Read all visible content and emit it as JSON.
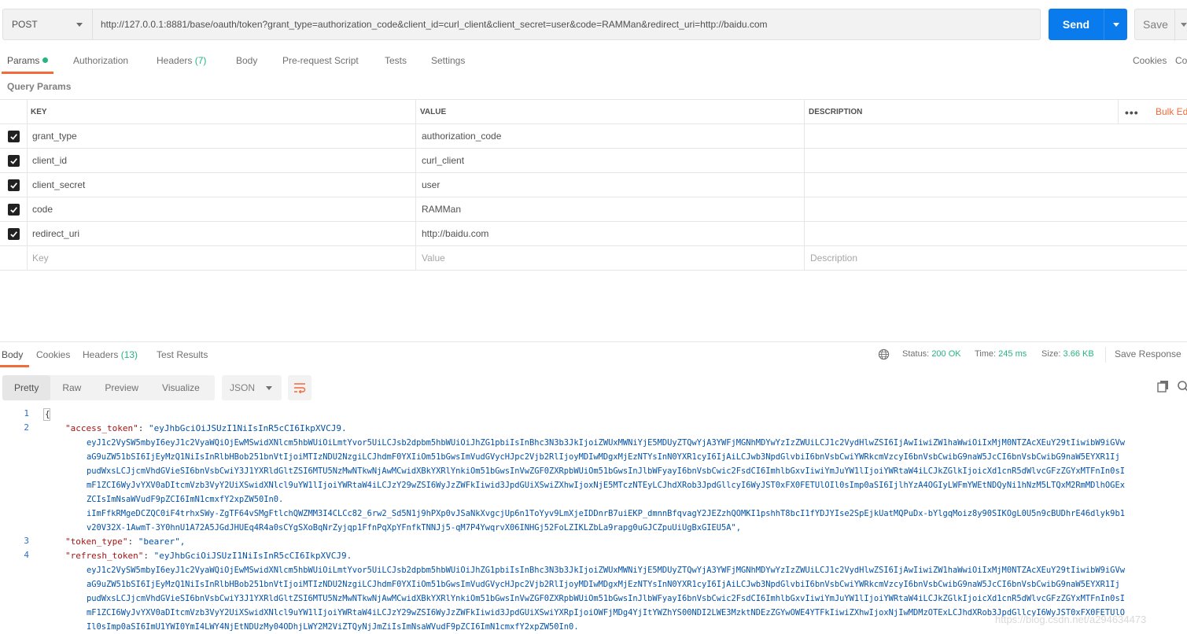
{
  "request": {
    "method": "POST",
    "url": "http://127.0.0.1:8881/base/oauth/token?grant_type=authorization_code&client_id=curl_client&client_secret=user&code=RAMMan&redirect_uri=http://baidu.com",
    "send_label": "Send",
    "save_label": "Save"
  },
  "request_tabs": {
    "params": "Params",
    "authorization": "Authorization",
    "headers": "Headers",
    "headers_count": "(7)",
    "body": "Body",
    "prerequest": "Pre-request Script",
    "tests": "Tests",
    "settings": "Settings",
    "cookies": "Cookies",
    "code": "Co"
  },
  "query_params": {
    "title": "Query Params",
    "columns": {
      "key": "KEY",
      "value": "VALUE",
      "description": "DESCRIPTION"
    },
    "bulk_edit": "Bulk Ed",
    "more": "•••",
    "rows": [
      {
        "key": "grant_type",
        "value": "authorization_code",
        "checked": true
      },
      {
        "key": "client_id",
        "value": "curl_client",
        "checked": true
      },
      {
        "key": "client_secret",
        "value": "user",
        "checked": true
      },
      {
        "key": "code",
        "value": "RAMMan",
        "checked": true
      },
      {
        "key": "redirect_uri",
        "value": "http://baidu.com",
        "checked": true
      }
    ],
    "placeholders": {
      "key": "Key",
      "value": "Value",
      "description": "Description"
    }
  },
  "response": {
    "tabs": {
      "body": "Body",
      "cookies": "Cookies",
      "headers": "Headers",
      "headers_count": "(13)",
      "test_results": "Test Results"
    },
    "status_label": "Status:",
    "status_value": "200 OK",
    "time_label": "Time:",
    "time_value": "245 ms",
    "size_label": "Size:",
    "size_value": "3.66 KB",
    "save_response": "Save Response",
    "views": [
      "Pretty",
      "Raw",
      "Preview",
      "Visualize"
    ],
    "format": "JSON",
    "line_numbers": [
      "1",
      "2",
      "3",
      "4"
    ],
    "json": {
      "open_brace": "{",
      "access_token_key": "\"access_token\"",
      "access_token_lines": [
        "\"eyJhbGciOiJSUzI1NiIsInR5cCI6IkpXVCJ9.",
        "eyJ1c2VySW5mbyI6eyJ1c2VyaWQiOjEwMSwidXNlcm5hbWUiOiLmtYvor5UiLCJsb2dpbm5hbWUiOiJhZG1pbiIsInBhc3N3b3JkIjoiZWUxMWNiYjE5MDUyZTQwYjA3YWFjMGNhMDYwYzIzZWUiLCJ1c2VydHlwZSI6IjAwIiwiZW1haWwiOiIxMjM0NTZAcXEuY29tIiwibW9iGVw",
        "aG9uZW51bSI6IjEyMzQ1NiIsInRlbHBob251bnVtIjoiMTIzNDU2NzgiLCJhdmF0YXIiOm51bGwsImVudGVycHJpc2Vjb2RlIjoyMDIwMDgxMjEzNTYsInN0YXR1cyI6IjAiLCJwb3NpdGlvbiI6bnVsbCwiYWRkcmVzcyI6bnVsbCwibG9naW5JcCI6bnVsbCwibG9naW5EYXR1Ij",
        "pudWxsLCJjcmVhdGVieSI6bnVsbCwiY3J1YXRldGltZSI6MTU5NzMwNTkwNjAwMCwidXBkYXRlYnkiOm51bGwsInVwZGF0ZXRpbWUiOm51bGwsInJlbWFyayI6bnVsbCwic2FsdCI6ImhlbGxvIiwiYmJuYW1lIjoiYWRtaW4iLCJkZGlkIjoicXd1cnR5dWlvcGFzZGYxMTFnIn0sI",
        "mF1ZCI6WyJvYXV0aDItcmVzb3VyY2UiXSwidXNlcl9uYW1lIjoiYWRtaW4iLCJzY29wZSI6WyJzZWFkIiwid3JpdGUiXSwiZXhwIjoxNjE5MTczNTEyLCJhdXRob3JpdGllcyI6WyJST0xFX0FETUlOIl0sImp0aSI6IjlhYzA4OGIyLWFmYWEtNDQyNi1hNzM5LTQxM2RmMDlhOGEx",
        "ZCIsImNsaWVudF9pZCI6ImN1cmxfY2xpZW50In0.",
        "iImFfkRMgeDCZQC0iF4trhxSWy-ZgTF64vSMgFtlchQWZMM3I4CLCc82_6rw2_Sd5N1j9hPXp0vJSaNkXvgcjUp6n1ToYyv9LmXjeIDDnrB7uiEKP_dmnnBfqvagY2JEZzhQOMKI1pshhT8bcI1fYDJYIse2SpEjkUatMQPuDx-bYlgqMoiz8y90SIKOgL0U5n9cBUDhrE46dlyk9b1",
        "v20V32X-1AwmT-3Y0hnU1A72A5JGdJHUEq4R4a0sCYgSXoBqNrZyjqp1FfnPqXpYFnfkTNNJj5-qM7P4YwqrvX06INHGj52FoLZIKLZbLa9rapg0uGJCZpuUiUgBxGIEU5A\","
      ],
      "token_type_key": "\"token_type\"",
      "token_type_value": "\"bearer\",",
      "refresh_token_key": "\"refresh_token\"",
      "refresh_token_lines": [
        "\"eyJhbGciOiJSUzI1NiIsInR5cCI6IkpXVCJ9.",
        "eyJ1c2VySW5mbyI6eyJ1c2VyaWQiOjEwMSwidXNlcm5hbWUiOiLmtYvor5UiLCJsb2dpbm5hbWUiOiJhZG1pbiIsInBhc3N3b3JkIjoiZWUxMWNiYjE5MDUyZTQwYjA3YWFjMGNhMDYwYzIzZWUiLCJ1c2VydHlwZSI6IjAwIiwiZW1haWwiOiIxMjM0NTZAcXEuY29tIiwibW9iGVw",
        "aG9uZW51bSI6IjEyMzQ1NiIsInRlbHBob251bnVtIjoiMTIzNDU2NzgiLCJhdmF0YXIiOm51bGwsImVudGVycHJpc2Vjb2RlIjoyMDIwMDgxMjEzNTYsInN0YXR1cyI6IjAiLCJwb3NpdGlvbiI6bnVsbCwiYWRkcmVzcyI6bnVsbCwibG9naW5JcCI6bnVsbCwibG9naW5EYXR1Ij",
        "pudWxsLCJjcmVhdGVieSI6bnVsbCwiY3J1YXRldGltZSI6MTU5NzMwNTkwNjAwMCwidXBkYXRlYnkiOm51bGwsInVwZGF0ZXRpbWUiOm51bGwsInJlbWFyayI6bnVsbCwic2FsdCI6ImhlbGxvIiwiYmJuYW1lIjoiYWRtaW4iLCJkZGlkIjoicXd1cnR5dWlvcGFzZGYxMTFnIn0sI",
        "mF1ZCI6WyJvYXV0aDItcmVzb3VyY2UiXSwidXNlcl9uYW1lIjoiYWRtaW4iLCJzY29wZSI6WyJzZWFkIiwid3JpdGUiXSwiYXRpIjoiOWFjMDg4YjItYWZhYS00NDI2LWE3MzktNDEzZGYwOWE4YTFkIiwiZXhwIjoxNjIwMDMzOTExLCJhdXRob3JpdGllcyI6WyJST0xFX0FETUlO",
        "Il0sImp0aSI6ImU1YWI0YmI4LWY4NjEtNDUzMy04ODhjLWY2M2ViZTQyNjJmZiIsImNsaWVudF9pZCI6ImN1cmxfY2xpZW50In0."
      ]
    },
    "watermark": "https://blog.csdn.net/a294634473"
  }
}
